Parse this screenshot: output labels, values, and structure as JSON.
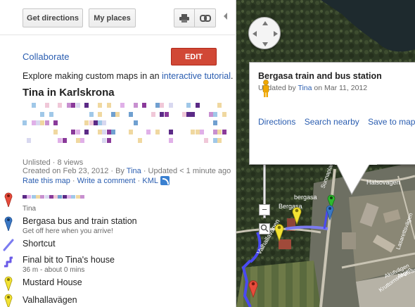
{
  "toolbar": {
    "get_directions": "Get directions",
    "my_places": "My places",
    "print_icon": "print-icon",
    "link_icon": "link-icon"
  },
  "map_header": {
    "collaborate": "Collaborate",
    "edit": "EDIT",
    "explore_prefix": "Explore making custom maps in an ",
    "explore_link": "interactive tutorial",
    "explore_suffix": ".",
    "title": "Tina in Karlskrona"
  },
  "meta": {
    "line1": "Unlisted · 8 views",
    "created_prefix": "Created on Feb 23, 2012 · By ",
    "created_author": "Tina",
    "created_suffix": " · Updated < 1 minute ago",
    "rate": "Rate this map",
    "write_comment": "Write a comment",
    "kml": "KML",
    "sep": " · "
  },
  "features": [
    {
      "icon": "red-pin-icon",
      "color": "#e74c3c",
      "name": "",
      "sub": "Tina",
      "type": "pin"
    },
    {
      "icon": "blue-pin-icon",
      "color": "#3b78c4",
      "name": "Bergasa bus and train station",
      "sub": "Get off here when you arrive!",
      "type": "pin"
    },
    {
      "icon": "line-icon",
      "color": "#7b7bf0",
      "name": "Shortcut",
      "sub": "",
      "type": "line"
    },
    {
      "icon": "path-icon",
      "color": "#6a5ae8",
      "name": "Final bit to Tina's house",
      "sub": "36 m - about 0 mins",
      "type": "path"
    },
    {
      "icon": "yellow-pin-icon",
      "color": "#f2e233",
      "name": "Mustard House",
      "sub": "",
      "type": "pin"
    },
    {
      "icon": "yellow-pin-icon",
      "color": "#f2e233",
      "name": "Valhallavägen",
      "sub": "",
      "type": "pin"
    }
  ],
  "infowindow": {
    "title": "Bergasa train and bus station",
    "updated_prefix": "Updated by ",
    "updated_author": "Tina",
    "updated_suffix": " on Mar 11, 2012",
    "directions": "Directions",
    "search_nearby": "Search nearby",
    "save_to_map": "Save to map"
  },
  "map_labels": {
    "bergasa": "bergasa",
    "bergasa2": "Bergasa",
    "halsovagen": "Halsovagen",
    "valhallavagen": "Valhallavägen",
    "sunnaplan": "Sunnaplan",
    "kruttornsvagen": "Kruttornsvägen",
    "akutvagen": "Akutvägen",
    "lassarettsvagen": "Lasarettsvägen",
    "akutv": "Akutvägen"
  },
  "colors": {
    "edit_red": "#d14836",
    "link_blue": "#2a5db0"
  }
}
